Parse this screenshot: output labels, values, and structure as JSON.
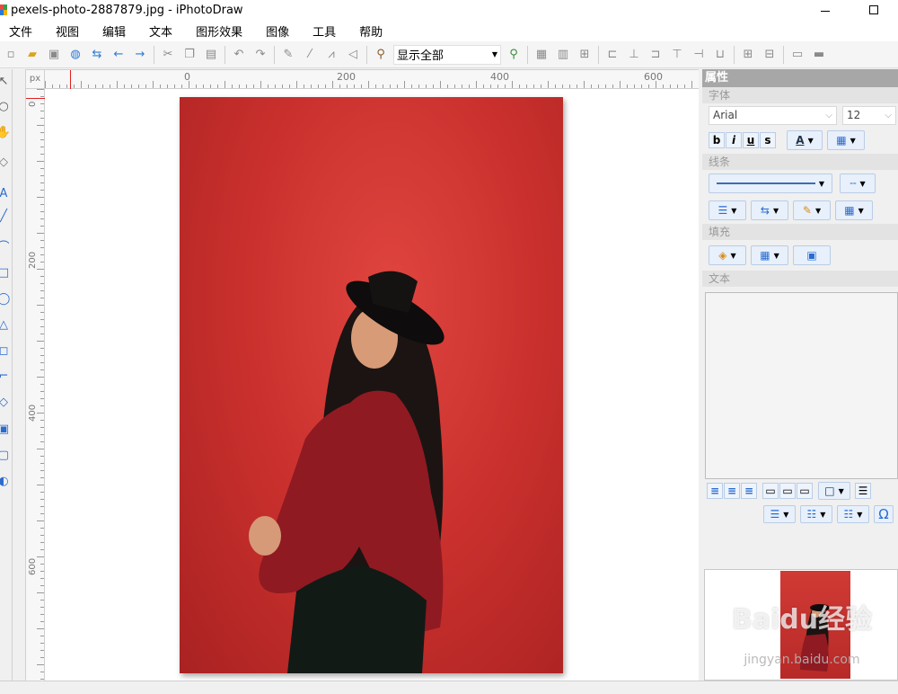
{
  "window": {
    "title": "pexels-photo-2887879.jpg - iPhotoDraw",
    "minimize_glyph": "—",
    "maximize_glyph": "☐"
  },
  "menu": [
    "文件",
    "视图",
    "编辑",
    "文本",
    "图形效果",
    "图像",
    "工具",
    "帮助"
  ],
  "toolbar": {
    "zoom_value": "显示全部"
  },
  "ruler": {
    "unit": "px",
    "h_labels": [
      "0",
      "200",
      "400",
      "600"
    ],
    "v_labels": [
      "0",
      "200",
      "400",
      "600"
    ]
  },
  "properties_panel": {
    "title": "属性",
    "font_section": "字体",
    "font_family": "Arial",
    "font_size": "12",
    "bold_label": "b",
    "italic_label": "i",
    "underline_label": "u",
    "strike_label": "s",
    "font_color_label": "A",
    "line_section": "线条",
    "fill_section": "填充",
    "text_section": "文本"
  },
  "thumbnail": {
    "watermark": "Baidu经验",
    "watermark_sub": "jingyan.baidu.com"
  },
  "colors": {
    "photo_background": "#c9302d",
    "accent_blue": "#2a7bd6",
    "panel_header": "#a7a7a7"
  }
}
